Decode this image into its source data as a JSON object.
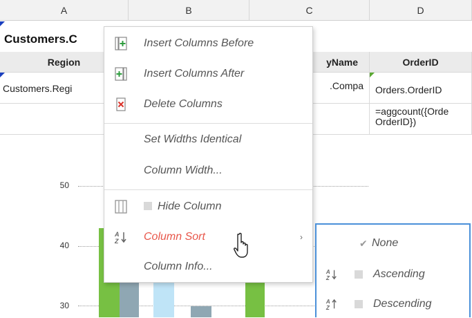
{
  "columns": [
    "A",
    "B",
    "C",
    "D"
  ],
  "title": "Customers.C",
  "header_row": {
    "region": "Region",
    "company": "yName",
    "orderid": "OrderID"
  },
  "data_row": {
    "region": "Customers.Regi",
    "company": ".Compa",
    "orderid": "Orders.OrderID"
  },
  "formula_row": {
    "line1": "=aggcount({Orde",
    "line2": "OrderID})"
  },
  "chart": {
    "y_labels": [
      "50",
      "40",
      "30"
    ]
  },
  "chart_data": {
    "type": "bar",
    "yticks": [
      30,
      40,
      50
    ],
    "series_colors": [
      "#77c043",
      "#8fa7b3",
      "#bfe4f7"
    ]
  },
  "context_menu": {
    "items": [
      {
        "label": "Insert Columns Before",
        "icon": "insert-before-icon"
      },
      {
        "label": "Insert Columns After",
        "icon": "insert-after-icon"
      },
      {
        "label": "Delete Columns",
        "icon": "delete-columns-icon"
      },
      {
        "label": "Set Widths Identical"
      },
      {
        "label": "Column Width..."
      },
      {
        "label": "Hide Column",
        "icon": "hide-column-icon"
      },
      {
        "label": "Column Sort",
        "icon": "sort-az-icon"
      },
      {
        "label": "Column Info..."
      }
    ]
  },
  "submenu": {
    "items": [
      {
        "label": "None",
        "checked": true
      },
      {
        "label": "Ascending",
        "icon": "sort-ascending-icon"
      },
      {
        "label": "Descending",
        "icon": "sort-descending-icon"
      }
    ]
  },
  "colors": {
    "accent": "#e8564a",
    "selection": "#4a90d9",
    "green": "#77c043"
  }
}
